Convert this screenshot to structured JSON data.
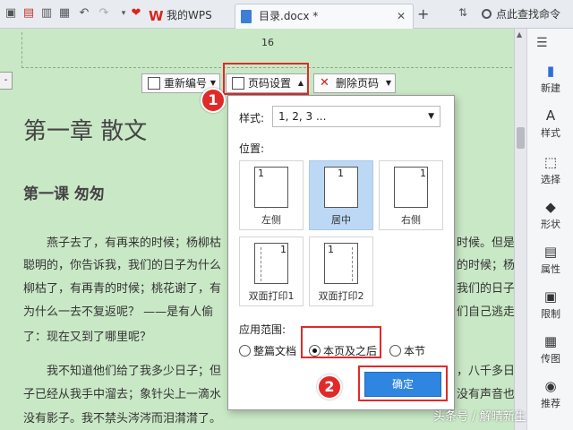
{
  "titlebar": {
    "tabs": [
      {
        "label": "我的WPS"
      },
      {
        "label": "目录.docx *"
      }
    ],
    "search_label": "点此查找命令"
  },
  "document": {
    "header_page_number": "16",
    "left_marker": "-",
    "chapter_title": "第一章  散文",
    "lesson_title": "第一课  匆匆",
    "paragraph1_left": [
      "燕子去了，有再来的时候；杨柳枯",
      "聪明的，你告诉我，我们的日子为什么",
      "柳枯了，有再青的时候；桃花谢了，有",
      "为什么一去不复返呢？ ——是有人偷",
      "了：现在又到了哪里呢？"
    ],
    "paragraph1_right": [
      "时候。但是",
      "的时候；杨",
      "我们的日子",
      "们自己逃走"
    ],
    "paragraph2_left": [
      "我不知道他们给了我多少日子；但",
      "子已经从我手中溜去；象针尖上一滴水",
      "没有影子。我不禁头涔涔而泪潸潸了。"
    ],
    "paragraph2_right": [
      "，八千多日",
      "没有声音也"
    ]
  },
  "page_number_toolbar": {
    "renumber_label": "重新编号",
    "page_setup_label": "页码设置",
    "delete_label": "删除页码"
  },
  "popup": {
    "style_label": "样式:",
    "style_value": "1, 2, 3 ...",
    "position_label": "位置:",
    "positions": [
      {
        "label": "左侧",
        "num": "1"
      },
      {
        "label": "居中",
        "num": "1"
      },
      {
        "label": "右侧",
        "num": "1"
      },
      {
        "label": "双面打印1",
        "num": "1"
      },
      {
        "label": "双面打印2",
        "num": "1"
      }
    ],
    "apply_label": "应用范围:",
    "apply_options": [
      {
        "label": "整篇文档",
        "checked": false
      },
      {
        "label": "本页及之后",
        "checked": true
      },
      {
        "label": "本节",
        "checked": false
      }
    ],
    "confirm_label": "确定"
  },
  "annotations": {
    "badge1": "1",
    "badge2": "2",
    "highlight_color": "#e02a2a"
  },
  "side_panel": {
    "items": [
      {
        "label": "新建",
        "icon": "new-icon"
      },
      {
        "label": "样式",
        "icon": "style-icon"
      },
      {
        "label": "选择",
        "icon": "select-icon"
      },
      {
        "label": "形状",
        "icon": "shape-icon"
      },
      {
        "label": "属性",
        "icon": "properties-icon"
      },
      {
        "label": "限制",
        "icon": "restrict-icon"
      },
      {
        "label": "传图",
        "icon": "upload-image-icon"
      },
      {
        "label": "推荐",
        "icon": "recommend-icon"
      }
    ]
  },
  "watermark": "头条号 / 解晴新生",
  "colors": {
    "doc_background": "#c9e8c6",
    "accent_blue": "#2f86e0",
    "selected_position": "#bcd8f4",
    "wps_red": "#d9251c"
  }
}
